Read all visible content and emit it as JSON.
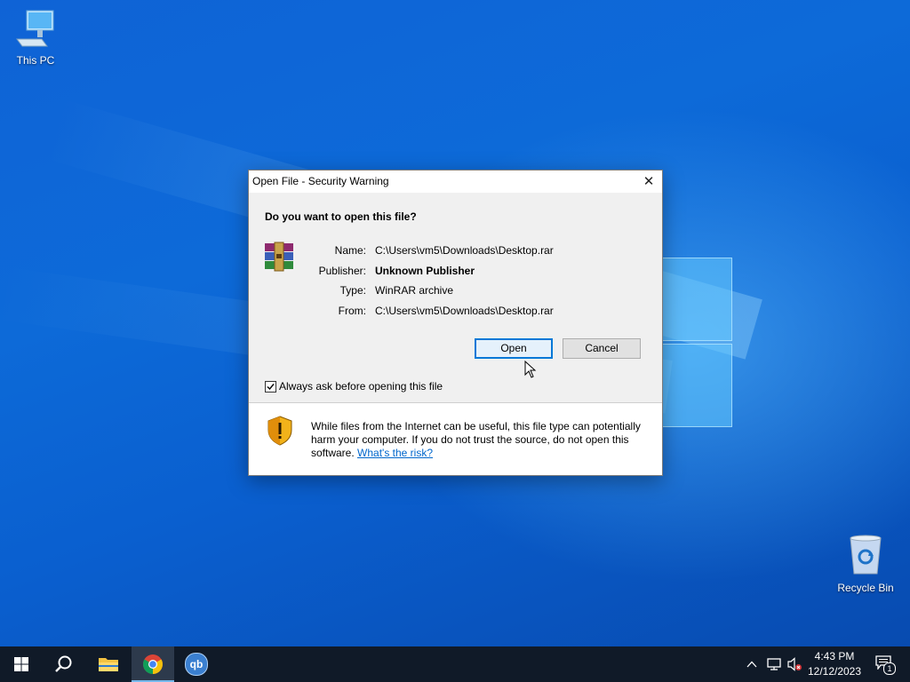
{
  "desktop": {
    "icons": [
      {
        "label": "This PC",
        "icon": "computer-icon"
      },
      {
        "label": "Recycle Bin",
        "icon": "recycle-bin-icon"
      }
    ]
  },
  "dialog": {
    "title": "Open File - Security Warning",
    "close_glyph": "✕",
    "question": "Do you want to open this file?",
    "file_icon": "winrar-archive-icon",
    "fields": [
      {
        "label": "Name:",
        "value": "C:\\Users\\vm5\\Downloads\\Desktop.rar"
      },
      {
        "label": "Publisher:",
        "value": "Unknown Publisher"
      },
      {
        "label": "Type:",
        "value": "WinRAR archive"
      },
      {
        "label": "From:",
        "value": "C:\\Users\\vm5\\Downloads\\Desktop.rar"
      }
    ],
    "buttons": {
      "open": "Open",
      "cancel": "Cancel"
    },
    "checkbox": {
      "label": "Always ask before opening this file",
      "checked": true
    },
    "warning": {
      "text": "While files from the Internet can be useful, this file type can potentially harm your computer. If you do not trust the source, do not open this software.",
      "link": "What's the risk?",
      "icon": "security-shield-icon"
    }
  },
  "taskbar": {
    "items": [
      "start-icon",
      "search-icon",
      "file-explorer-icon",
      "chrome-icon",
      "qbittorrent-icon"
    ],
    "qbittorrent_glyph": "qb",
    "active_item": "chrome-icon",
    "tray": {
      "icons": [
        "chevron-up-icon",
        "network-icon",
        "volume-muted-icon"
      ],
      "time": "4:43 PM",
      "date": "12/12/2023",
      "notification_count": "1"
    }
  },
  "colors": {
    "desktop_blue": "#0a58c4",
    "taskbar": "#101a28",
    "accent": "#0078d7",
    "link": "#0066cc"
  }
}
